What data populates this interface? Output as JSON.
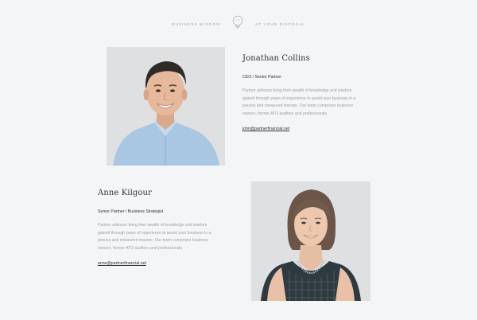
{
  "header": {
    "left_text": "BUSINESS WISDOM",
    "right_text": "AT YOUR DISPOSAL",
    "icon": "lightbulb-icon"
  },
  "team": [
    {
      "name": "Jonathan Collins",
      "role": "CEO / Senior Partner",
      "description": "Partner advisors bring their wealth of knowledge and wisdom gained through years of experience to assist your business in a precise and measured manner. Our team comprises business owners, former ATO auditors and professionals.",
      "email": "john@partnerfinancial.net"
    },
    {
      "name": "Anne Kilgour",
      "role": "Senior Partner / Business Strategist",
      "description": "Partner advisors bring their wealth of knowledge and wisdom gained through years of experience to assist your business in a precise and measured manner. Our team comprises business owners, former ATO auditors and professionals.",
      "email": "anne@partnerfinancial.net"
    }
  ],
  "colors": {
    "background": "#f4f5f7",
    "photo_bg": "#dedfe1",
    "muted_text": "#9a9fa6",
    "heading_text": "#333333"
  }
}
